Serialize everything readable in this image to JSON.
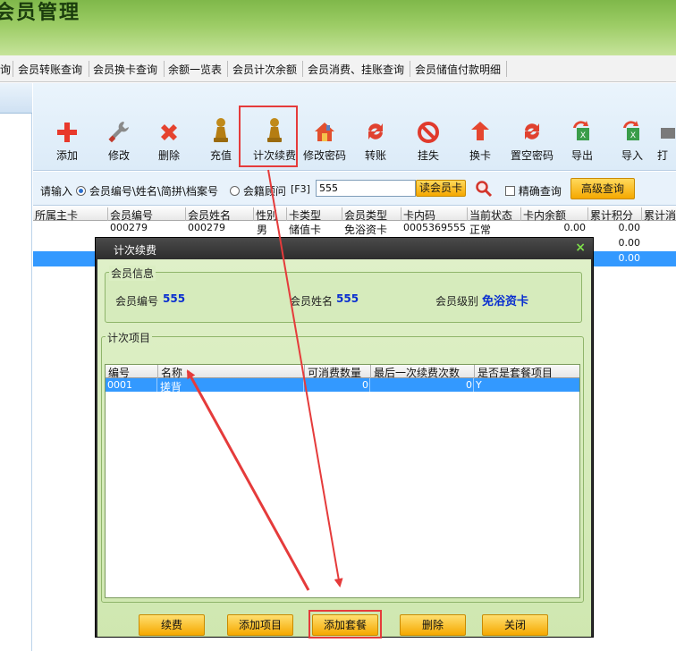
{
  "app": {
    "title": "会员管理"
  },
  "menu": [
    "询",
    "会员转账查询",
    "会员换卡查询",
    "余额一览表",
    "会员计次余额",
    "会员消费、挂账查询",
    "会员储值付款明细"
  ],
  "toolbar": {
    "add": "添加",
    "edit": "修改",
    "delete": "删除",
    "recharge": "充值",
    "count_renew": "计次续费",
    "change_password": "修改密码",
    "transfer": "转账",
    "report_loss": "挂失",
    "change_card": "换卡",
    "clear_password": "置空密码",
    "export": "导出",
    "import": "导入",
    "more": "打"
  },
  "search": {
    "prompt": "请输入",
    "option_member": "会员编号\\姓名\\简拼\\档案号",
    "option_advisor": "会籍顾问",
    "hotkey": "[F3]",
    "value": "555",
    "read_card": "读会员卡",
    "exact": "精确查询",
    "advanced": "高级查询"
  },
  "grid": {
    "headers": [
      "所属主卡",
      "会员编号",
      "会员姓名",
      "性别",
      "卡类型",
      "会员类型",
      "卡内码",
      "当前状态",
      "卡内余额",
      "累计积分",
      "累计消"
    ],
    "rows": [
      {
        "member_no": "000279",
        "name": "000279",
        "gender": "男",
        "card_type": "储值卡",
        "member_type": "免浴资卡",
        "card_code": "0005369555",
        "status": "正常",
        "balance": "0.00",
        "points": "0.00"
      },
      {
        "points": "0.00"
      },
      {
        "points": "0.00"
      }
    ]
  },
  "dialog": {
    "title": "计次续费",
    "close": "×",
    "member_info": {
      "caption": "会员信息",
      "no_label": "会员编号",
      "no_value": "555",
      "name_label": "会员姓名",
      "name_value": "555",
      "level_label": "会员级别",
      "level_value": "免浴资卡"
    },
    "items": {
      "caption": "计次项目",
      "headers": [
        "编号",
        "名称",
        "可消费数量",
        "最后一次续费次数",
        "是否是套餐项目"
      ],
      "rows": [
        {
          "code": "0001",
          "name": "搓背",
          "qty": "0",
          "last_count": "0",
          "is_package": "Y"
        }
      ]
    },
    "buttons": {
      "renew": "续费",
      "add_item": "添加项目",
      "add_package": "添加套餐",
      "delete": "删除",
      "close": "关闭"
    }
  },
  "colors": {
    "highlight": "#e53b3b",
    "accent": "#3399ff",
    "dialog_bg": "#d6ebbc"
  }
}
